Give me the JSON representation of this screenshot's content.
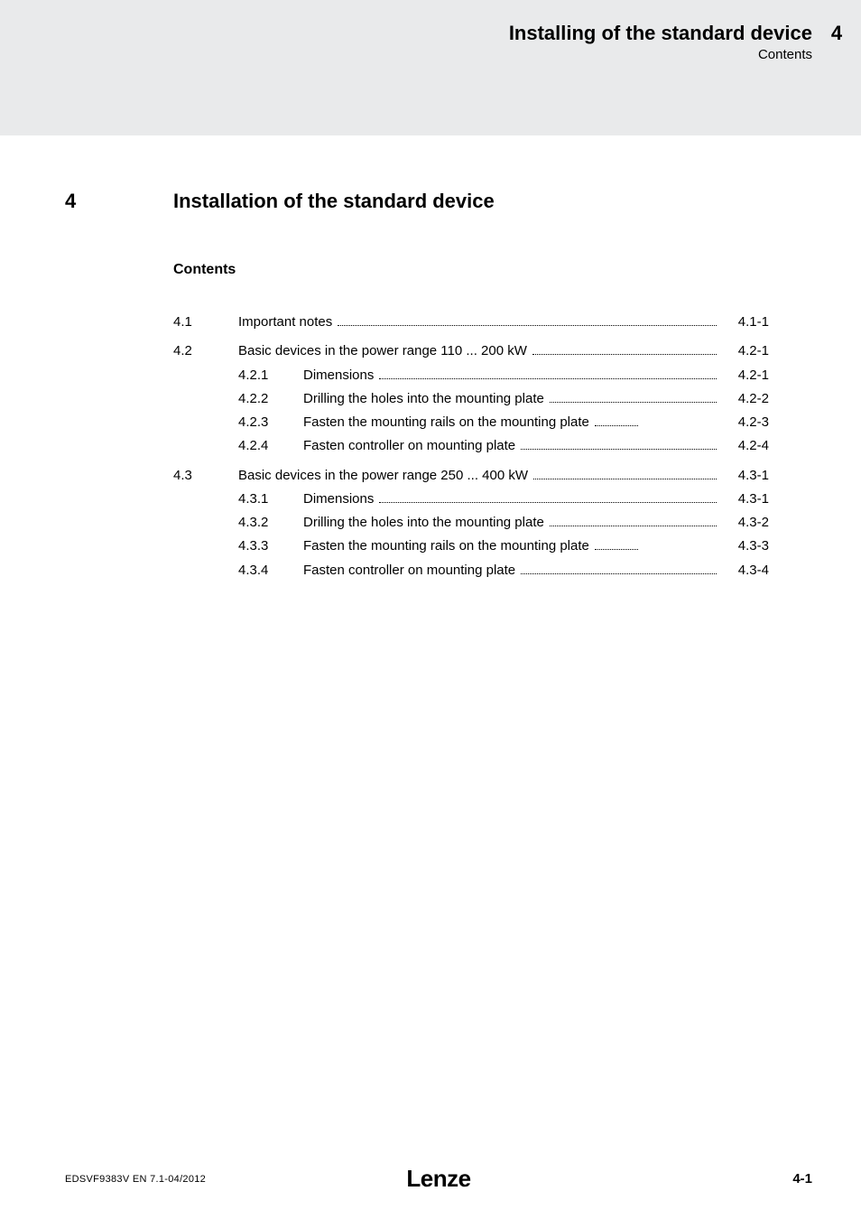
{
  "header": {
    "title": "Installing of the standard device",
    "subtitle": "Contents",
    "page_top": "4"
  },
  "chapter": {
    "number": "4",
    "title": "Installation of the standard device"
  },
  "contents_heading": "Contents",
  "toc": [
    {
      "level": 1,
      "num": "4.1",
      "text": "Important notes",
      "page": "4.1-1"
    },
    {
      "level": 1,
      "num": "4.2",
      "text": "Basic devices in the power range 110 ... 200 kW",
      "page": "4.2-1"
    },
    {
      "level": 2,
      "num": "4.2.1",
      "text": "Dimensions",
      "page": "4.2-1"
    },
    {
      "level": 2,
      "num": "4.2.2",
      "text": "Drilling the holes into the mounting plate",
      "page": "4.2-2"
    },
    {
      "level": 2,
      "num": "4.2.3",
      "text": "Fasten the mounting rails on the mounting plate",
      "page": "4.2-3",
      "short_dots": true
    },
    {
      "level": 2,
      "num": "4.2.4",
      "text": "Fasten controller on mounting plate",
      "page": "4.2-4"
    },
    {
      "level": 1,
      "num": "4.3",
      "text": "Basic devices in the power range 250 ... 400 kW",
      "page": "4.3-1"
    },
    {
      "level": 2,
      "num": "4.3.1",
      "text": "Dimensions",
      "page": "4.3-1"
    },
    {
      "level": 2,
      "num": "4.3.2",
      "text": "Drilling the holes into the mounting plate",
      "page": "4.3-2"
    },
    {
      "level": 2,
      "num": "4.3.3",
      "text": "Fasten the mounting rails on the mounting plate",
      "page": "4.3-3",
      "short_dots": true
    },
    {
      "level": 2,
      "num": "4.3.4",
      "text": "Fasten controller on mounting plate",
      "page": "4.3-4"
    }
  ],
  "footer": {
    "left": "EDSVF9383V  EN  7.1-04/2012",
    "center": "Lenze",
    "right": "4-1"
  }
}
